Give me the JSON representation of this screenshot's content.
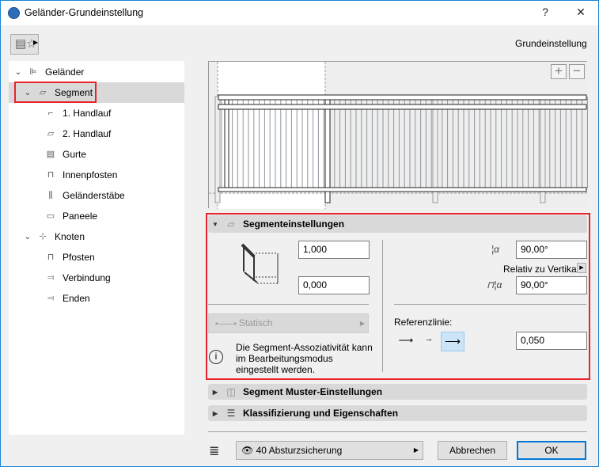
{
  "window": {
    "title": "Geländer-Grundeinstellung",
    "help": "?",
    "close": "✕"
  },
  "header": {
    "mode_label": "Grundeinstellung"
  },
  "tree": [
    {
      "label": "Geländer",
      "level": 0,
      "expanded": true
    },
    {
      "label": "Segment",
      "level": 1,
      "expanded": true,
      "selected": true
    },
    {
      "label": "1. Handlauf",
      "level": 2
    },
    {
      "label": "2. Handlauf",
      "level": 2
    },
    {
      "label": "Gurte",
      "level": 2
    },
    {
      "label": "Innenpfosten",
      "level": 2
    },
    {
      "label": "Geländerstäbe",
      "level": 2
    },
    {
      "label": "Paneele",
      "level": 2
    },
    {
      "label": "Knoten",
      "level": 1,
      "expanded": true
    },
    {
      "label": "Pfosten",
      "level": 2
    },
    {
      "label": "Verbindung",
      "level": 2
    },
    {
      "label": "Enden",
      "level": 2
    }
  ],
  "preview": {
    "zoom_in": "+",
    "zoom_out": "−"
  },
  "segment_settings": {
    "title": "Segmenteinstellungen",
    "height": "1,000",
    "offset": "0,000",
    "angle1": "90,00°",
    "relative_label": "Relativ zu Vertikal",
    "angle2": "90,00°",
    "assoc_button": "Statisch",
    "info_text": "Die Segment-Assoziativität kann im Bearbeitungsmodus eingestellt werden.",
    "ref_label": "Referenzlinie:",
    "ref_offset": "0,050",
    "ref_selected": 2
  },
  "sections": [
    {
      "title": "Segment Muster-Einstellungen"
    },
    {
      "title": "Klassifizierung und Eigenschaften"
    }
  ],
  "footer": {
    "layer": "40 Absturzsicherung",
    "cancel": "Abbrechen",
    "ok": "OK"
  },
  "colors": {
    "accent": "#0078d7",
    "highlight": "#e8232a",
    "selected_bg": "#cce4f7"
  }
}
